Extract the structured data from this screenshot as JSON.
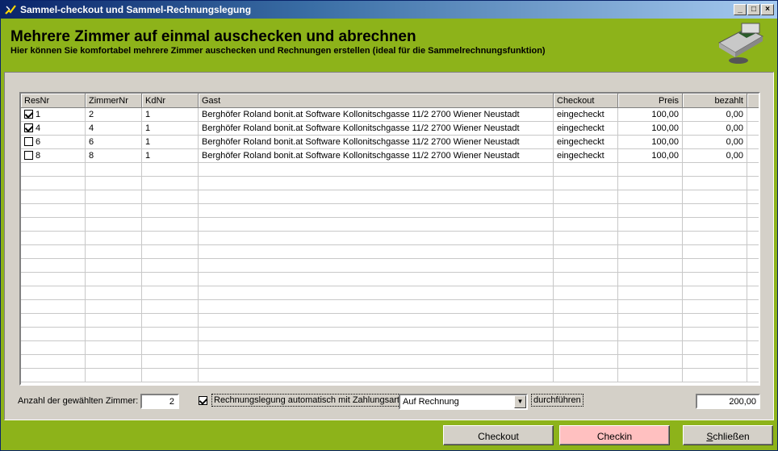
{
  "window": {
    "title": "Sammel-checkout und Sammel-Rechnungslegung"
  },
  "header": {
    "title": "Mehrere Zimmer auf einmal auschecken und abrechnen",
    "subtitle": "Hier können Sie komfortabel mehrere Zimmer auschecken und Rechnungen erstellen (ideal für die Sammelrechnungsfunktion)"
  },
  "table": {
    "columns": [
      "ResNr",
      "ZimmerNr",
      "KdNr",
      "Gast",
      "Checkout",
      "Preis",
      "bezahlt"
    ],
    "rows": [
      {
        "checked": true,
        "resnr": "1",
        "zimmer": "2",
        "kdnr": "1",
        "gast": "Berghöfer Roland bonit.at Software Kollonitschgasse 11/2 2700 Wiener Neustadt",
        "checkout": "eingecheckt",
        "preis": "100,00",
        "bezahlt": "0,00"
      },
      {
        "checked": true,
        "resnr": "4",
        "zimmer": "4",
        "kdnr": "1",
        "gast": "Berghöfer Roland bonit.at Software Kollonitschgasse 11/2 2700 Wiener Neustadt",
        "checkout": "eingecheckt",
        "preis": "100,00",
        "bezahlt": "0,00"
      },
      {
        "checked": false,
        "resnr": "6",
        "zimmer": "6",
        "kdnr": "1",
        "gast": "Berghöfer Roland bonit.at Software Kollonitschgasse 11/2 2700 Wiener Neustadt",
        "checkout": "eingecheckt",
        "preis": "100,00",
        "bezahlt": "0,00"
      },
      {
        "checked": false,
        "resnr": "8",
        "zimmer": "8",
        "kdnr": "1",
        "gast": "Berghöfer Roland bonit.at Software Kollonitschgasse 11/2 2700 Wiener Neustadt",
        "checkout": "eingecheckt",
        "preis": "100,00",
        "bezahlt": "0,00"
      }
    ]
  },
  "footer": {
    "count_label": "Anzahl der gewählten Zimmer:",
    "count_value": "2",
    "auto_invoice_label": "Rechnungslegung automatisch mit Zahlungsart",
    "payment_method": "Auf Rechnung",
    "execute_label": "durchführen",
    "total": "200,00"
  },
  "buttons": {
    "checkout": "Checkout",
    "checkin": "Checkin",
    "close": "Schließen"
  }
}
